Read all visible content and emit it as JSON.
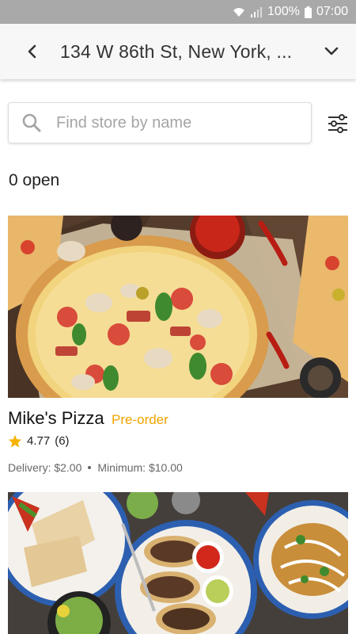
{
  "status_bar": {
    "battery": "100%",
    "time": "07:00"
  },
  "header": {
    "address": "134 W 86th St, New York, ..."
  },
  "search": {
    "placeholder": "Find store by name",
    "value": ""
  },
  "list": {
    "open_count": "0 open"
  },
  "stores": [
    {
      "name": "Mike's Pizza",
      "badge": "Pre-order",
      "rating": "4.77",
      "reviews": "(6)",
      "delivery": "Delivery: $2.00",
      "minimum": "Minimum: $10.00",
      "image": "pizza-photo"
    },
    {
      "image": "tacos-photo"
    }
  ],
  "colors": {
    "accent": "#f0a400",
    "status_bar": "#a9a9a9",
    "star": "#f5b301"
  }
}
